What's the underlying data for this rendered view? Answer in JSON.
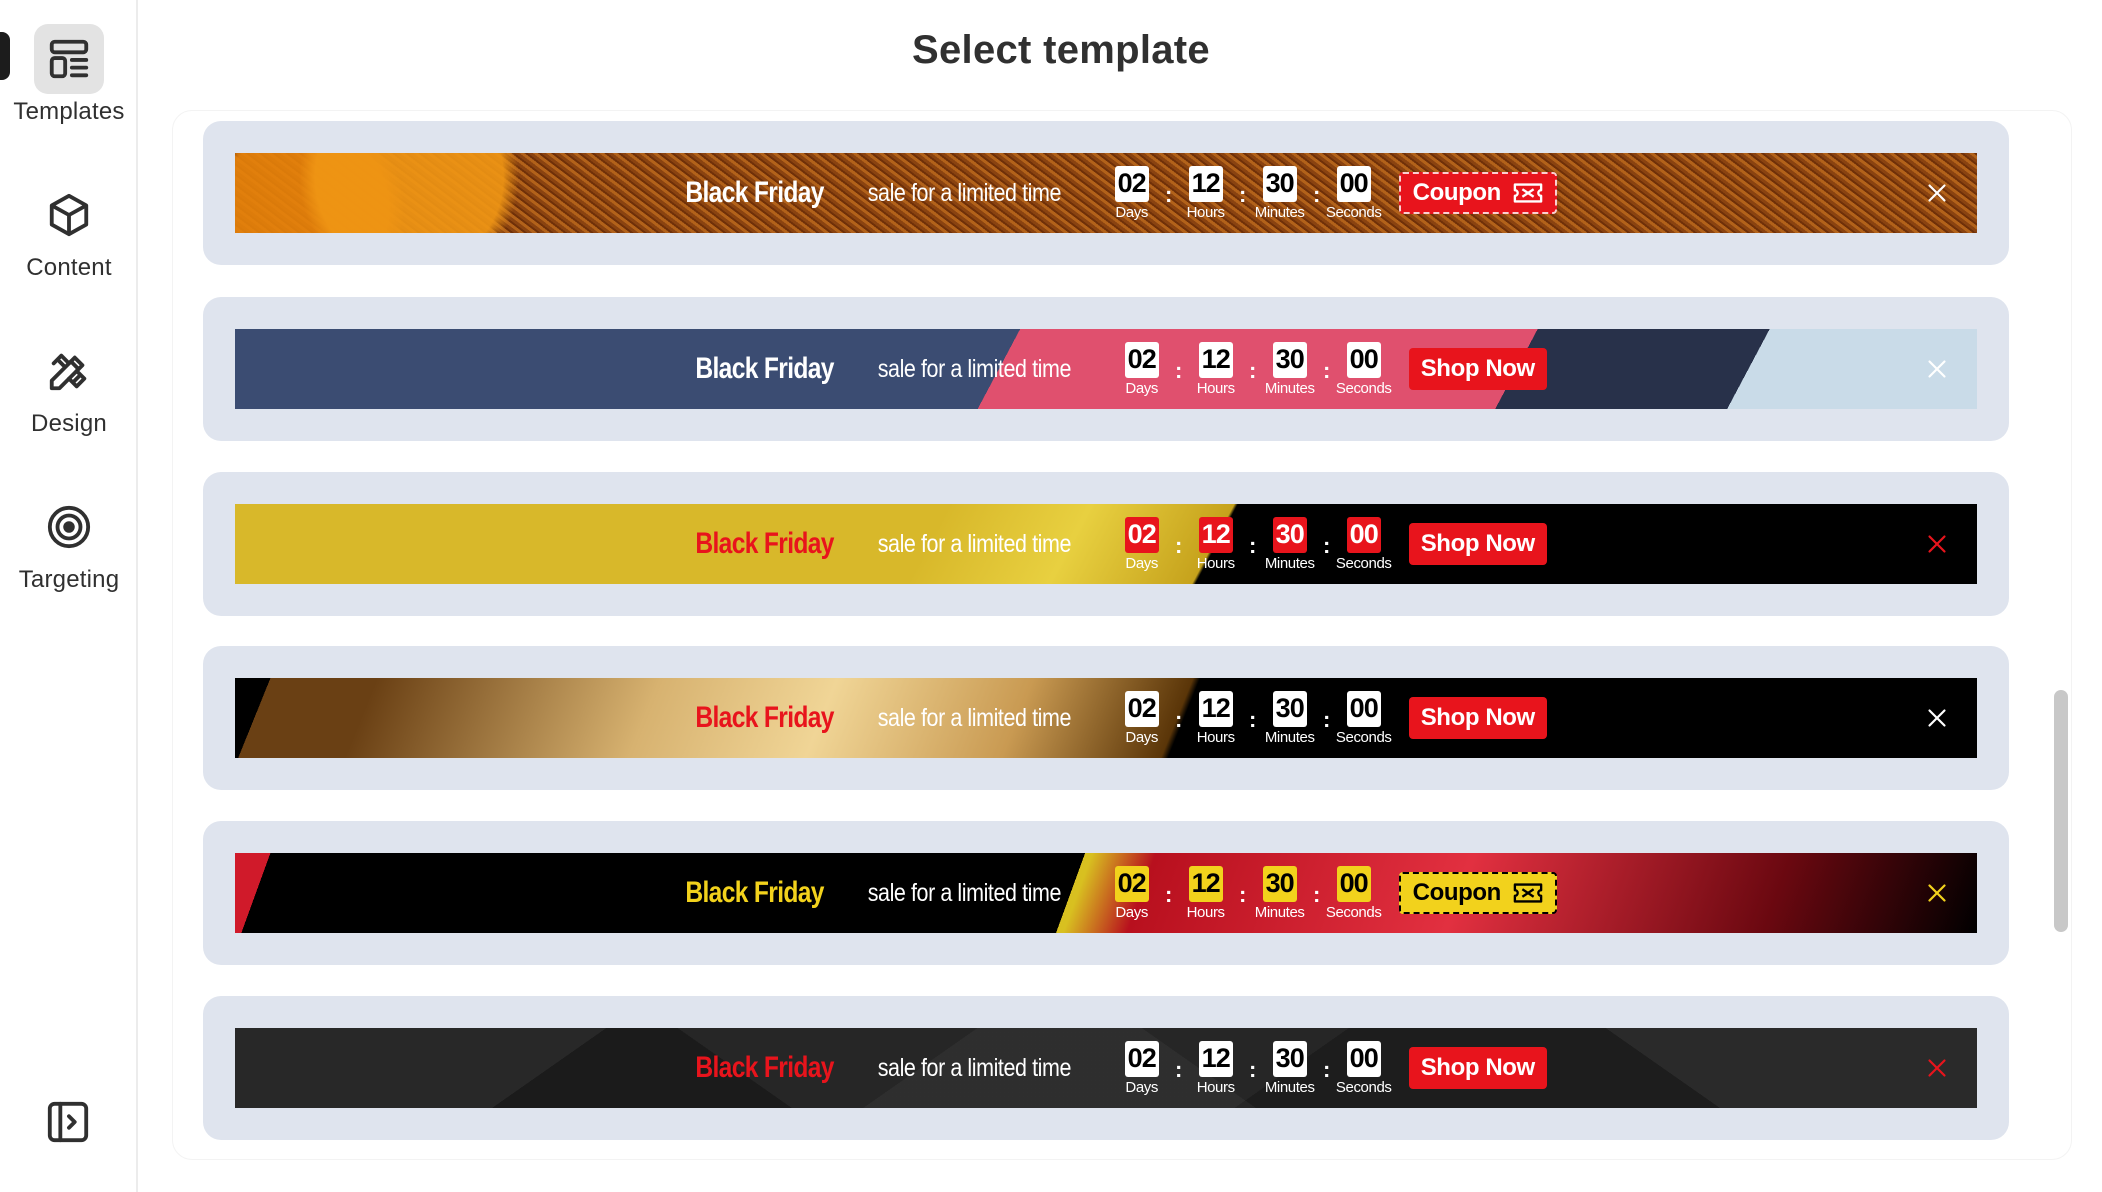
{
  "nav": {
    "items": [
      {
        "label": "Templates",
        "icon": "templates-icon",
        "active": true
      },
      {
        "label": "Content",
        "icon": "cube-icon",
        "active": false
      },
      {
        "label": "Design",
        "icon": "pencil-ruler-icon",
        "active": false
      },
      {
        "label": "Targeting",
        "icon": "target-icon",
        "active": false
      }
    ],
    "collapse_icon": "sidebar-toggle-icon"
  },
  "page": {
    "title": "Select template"
  },
  "templates": [
    {
      "title": "Black Friday",
      "subtitle": "sale for a limited time",
      "timer": [
        {
          "num": "02",
          "label": "Days"
        },
        {
          "num": "12",
          "label": "Hours"
        },
        {
          "num": "30",
          "label": "Minutes"
        },
        {
          "num": "00",
          "label": "Seconds"
        }
      ],
      "cta": "Coupon",
      "cta_icon": "ticket-icon",
      "colors": {
        "title": "#ffffff",
        "subtitle": "#ffffff",
        "num_bg": "#ffffff",
        "num_fg": "#000000",
        "label": "#ffffff",
        "cta_bg": "#e8141c",
        "cta_fg": "#ffffff",
        "close": "#ffffff"
      }
    },
    {
      "title": "Black Friday",
      "subtitle": "sale for a limited time",
      "timer": [
        {
          "num": "02",
          "label": "Days"
        },
        {
          "num": "12",
          "label": "Hours"
        },
        {
          "num": "30",
          "label": "Minutes"
        },
        {
          "num": "00",
          "label": "Seconds"
        }
      ],
      "cta": "Shop Now",
      "cta_icon": "",
      "colors": {
        "title": "#ffffff",
        "subtitle": "#ffffff",
        "num_bg": "#ffffff",
        "num_fg": "#000000",
        "label": "#ffffff",
        "cta_bg": "#e8141c",
        "cta_fg": "#ffffff",
        "close": "#ffffff"
      }
    },
    {
      "title": "Black Friday",
      "subtitle": "sale for a limited time",
      "timer": [
        {
          "num": "02",
          "label": "Days"
        },
        {
          "num": "12",
          "label": "Hours"
        },
        {
          "num": "30",
          "label": "Minutes"
        },
        {
          "num": "00",
          "label": "Seconds"
        }
      ],
      "cta": "Shop Now",
      "cta_icon": "",
      "colors": {
        "title": "#e8141c",
        "subtitle": "#ffffff",
        "num_bg": "#e8141c",
        "num_fg": "#ffffff",
        "label": "#ffffff",
        "cta_bg": "#e8141c",
        "cta_fg": "#ffffff",
        "close": "#e8141c"
      }
    },
    {
      "title": "Black Friday",
      "subtitle": "sale for a limited time",
      "timer": [
        {
          "num": "02",
          "label": "Days"
        },
        {
          "num": "12",
          "label": "Hours"
        },
        {
          "num": "30",
          "label": "Minutes"
        },
        {
          "num": "00",
          "label": "Seconds"
        }
      ],
      "cta": "Shop Now",
      "cta_icon": "",
      "colors": {
        "title": "#e8141c",
        "subtitle": "#ffffff",
        "num_bg": "#ffffff",
        "num_fg": "#000000",
        "label": "#ffffff",
        "cta_bg": "#e8141c",
        "cta_fg": "#ffffff",
        "close": "#ffffff"
      }
    },
    {
      "title": "Black Friday",
      "subtitle": "sale for a limited time",
      "timer": [
        {
          "num": "02",
          "label": "Days"
        },
        {
          "num": "12",
          "label": "Hours"
        },
        {
          "num": "30",
          "label": "Minutes"
        },
        {
          "num": "00",
          "label": "Seconds"
        }
      ],
      "cta": "Coupon",
      "cta_icon": "ticket-icon",
      "colors": {
        "title": "#f2d21c",
        "subtitle": "#ffffff",
        "num_bg": "#f2d21c",
        "num_fg": "#000000",
        "label": "#ffffff",
        "cta_bg": "#f2d21c",
        "cta_fg": "#000000",
        "close": "#f2d21c"
      }
    },
    {
      "title": "Black Friday",
      "subtitle": "sale for a limited time",
      "timer": [
        {
          "num": "02",
          "label": "Days"
        },
        {
          "num": "12",
          "label": "Hours"
        },
        {
          "num": "30",
          "label": "Minutes"
        },
        {
          "num": "00",
          "label": "Seconds"
        }
      ],
      "cta": "Shop Now",
      "cta_icon": "",
      "colors": {
        "title": "#e8141c",
        "subtitle": "#ffffff",
        "num_bg": "#ffffff",
        "num_fg": "#000000",
        "label": "#ffffff",
        "cta_bg": "#e8141c",
        "cta_fg": "#ffffff",
        "close": "#e8141c"
      }
    }
  ]
}
